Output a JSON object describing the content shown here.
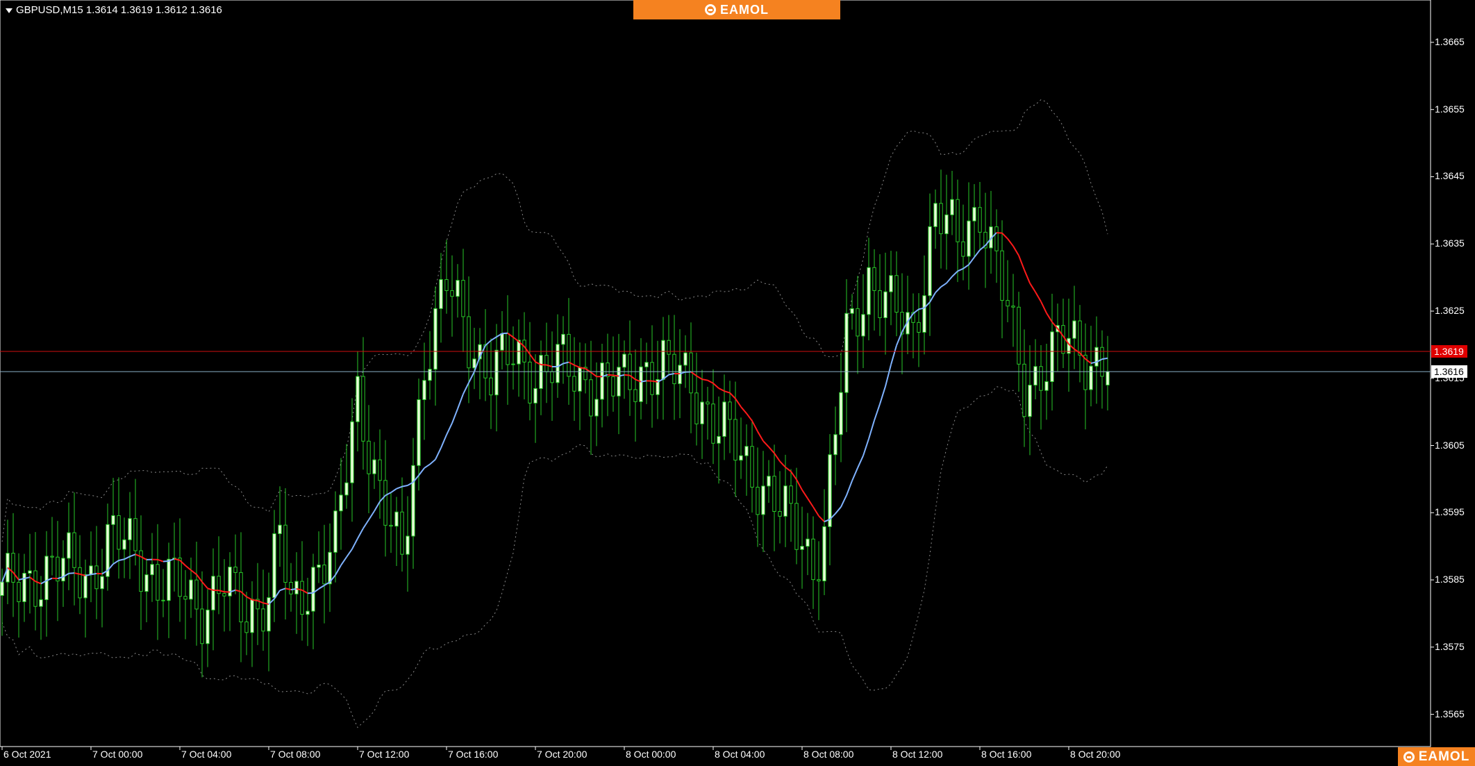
{
  "header": {
    "symbol_info": "GBPUSD,M15  1.3614 1.3619 1.3612 1.3616"
  },
  "brand": {
    "top_label": "EAMOL",
    "bottom_label": "EAMOL",
    "color": "#f58220"
  },
  "price_tags": {
    "ask": "1.3619",
    "bid": "1.3616"
  },
  "colors": {
    "background": "#000000",
    "frame": "#ffffff",
    "candle_bull_body": "#e8ffd8",
    "candle_bear_body": "#000000",
    "candle_wick": "#28c828",
    "ma_falling": "#ff1a1a",
    "ma_rising": "#7fb2ff",
    "bands": "#8a8a8a",
    "ask_line": "#d01010",
    "bid_line": "#8ab0c8"
  },
  "chart_data": {
    "type": "candlestick",
    "symbol": "GBPUSD",
    "timeframe": "M15",
    "ohlc_header": {
      "open": 1.3614,
      "high": 1.3619,
      "low": 1.3612,
      "close": 1.3616
    },
    "ylim": [
      1.35602,
      1.36713
    ],
    "y_ticks": [
      "1.3665",
      "1.3655",
      "1.3645",
      "1.3635",
      "1.3625",
      "1.3615",
      "1.3605",
      "1.3595",
      "1.3585",
      "1.3575",
      "1.3565"
    ],
    "x_ticks": [
      "6 Oct 2021",
      "7 Oct 00:00",
      "7 Oct 04:00",
      "7 Oct 08:00",
      "7 Oct 12:00",
      "7 Oct 16:00",
      "7 Oct 20:00",
      "8 Oct 00:00",
      "8 Oct 04:00",
      "8 Oct 08:00",
      "8 Oct 12:00",
      "8 Oct 16:00",
      "8 Oct 20:00"
    ],
    "ask_price": 1.3619,
    "bid_price": 1.3616,
    "candle_interval_minutes": 15,
    "close_anchors": [
      [
        "6 Oct 2021 20:00",
        1.3583
      ],
      [
        "6 Oct 2021 21:00",
        1.3585
      ],
      [
        "6 Oct 2021 22:00",
        1.3586
      ],
      [
        "6 Oct 2021 23:00",
        1.3587
      ],
      [
        "7 Oct 00:00",
        1.3586
      ],
      [
        "7 Oct 01:00",
        1.3591
      ],
      [
        "7 Oct 02:00",
        1.359
      ],
      [
        "7 Oct 03:00",
        1.3584
      ],
      [
        "7 Oct 04:00",
        1.3584
      ],
      [
        "7 Oct 05:00",
        1.3581
      ],
      [
        "7 Oct 06:00",
        1.3584
      ],
      [
        "7 Oct 07:00",
        1.358
      ],
      [
        "7 Oct 08:00",
        1.3583
      ],
      [
        "7 Oct 08:30",
        1.3592
      ],
      [
        "7 Oct 09:00",
        1.358
      ],
      [
        "7 Oct 10:00",
        1.3586
      ],
      [
        "7 Oct 11:00",
        1.359
      ],
      [
        "7 Oct 12:00",
        1.3613
      ],
      [
        "7 Oct 13:00",
        1.3598
      ],
      [
        "7 Oct 14:00",
        1.3587
      ],
      [
        "7 Oct 15:00",
        1.3618
      ],
      [
        "7 Oct 16:00",
        1.3629
      ],
      [
        "7 Oct 17:00",
        1.3621
      ],
      [
        "7 Oct 18:00",
        1.3616
      ],
      [
        "7 Oct 19:00",
        1.3618
      ],
      [
        "7 Oct 20:00",
        1.3616
      ],
      [
        "7 Oct 21:00",
        1.3617
      ],
      [
        "7 Oct 22:00",
        1.3615
      ],
      [
        "7 Oct 23:00",
        1.3614
      ],
      [
        "8 Oct 00:00",
        1.3614
      ],
      [
        "8 Oct 01:00",
        1.3617
      ],
      [
        "8 Oct 02:00",
        1.3616
      ],
      [
        "8 Oct 03:00",
        1.3615
      ],
      [
        "8 Oct 04:00",
        1.3608
      ],
      [
        "8 Oct 05:00",
        1.3605
      ],
      [
        "8 Oct 06:00",
        1.36
      ],
      [
        "8 Oct 07:00",
        1.3595
      ],
      [
        "8 Oct 08:00",
        1.3592
      ],
      [
        "8 Oct 08:30",
        1.3587
      ],
      [
        "8 Oct 09:00",
        1.3592
      ],
      [
        "8 Oct 10:00",
        1.3621
      ],
      [
        "8 Oct 11:00",
        1.363
      ],
      [
        "8 Oct 12:00",
        1.3625
      ],
      [
        "8 Oct 13:00",
        1.3622
      ],
      [
        "8 Oct 14:00",
        1.364
      ],
      [
        "8 Oct 15:00",
        1.3635
      ],
      [
        "8 Oct 16:00",
        1.3641
      ],
      [
        "8 Oct 17:00",
        1.3628
      ],
      [
        "8 Oct 18:00",
        1.3614
      ],
      [
        "8 Oct 19:00",
        1.3617
      ],
      [
        "8 Oct 20:00",
        1.3621
      ],
      [
        "8 Oct 21:00",
        1.3618
      ],
      [
        "8 Oct 21:45",
        1.3616
      ]
    ],
    "indicators": {
      "moving_average": "two-colour MA (red when falling above price, blue when rising)",
      "bands": "dotted envelope bands above and below price"
    },
    "grid": false
  }
}
